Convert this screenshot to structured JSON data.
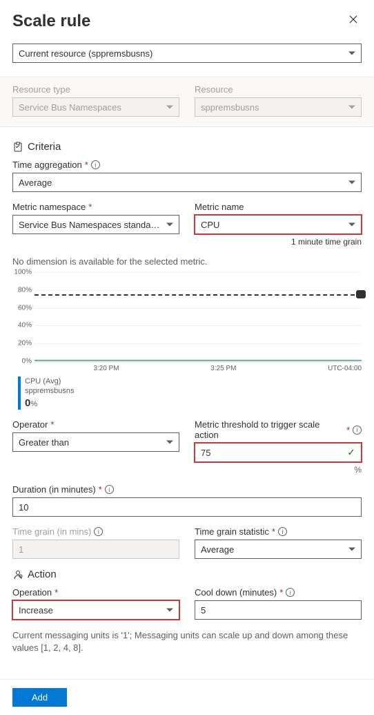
{
  "header": {
    "title": "Scale rule"
  },
  "scope_select": {
    "value": "Current resource (sppremsbusns)"
  },
  "resource_type": {
    "label": "Resource type",
    "value": "Service Bus Namespaces"
  },
  "resource": {
    "label": "Resource",
    "value": "sppremsbusns"
  },
  "criteria": {
    "title": "Criteria"
  },
  "time_agg": {
    "label": "Time aggregation",
    "value": "Average"
  },
  "metric_ns": {
    "label": "Metric namespace",
    "value": "Service Bus Namespaces standard me..."
  },
  "metric_name": {
    "label": "Metric name",
    "value": "CPU"
  },
  "time_grain_note": "1 minute time grain",
  "no_dim_msg": "No dimension is available for the selected metric.",
  "chart_data": {
    "type": "line",
    "yticks": [
      "100%",
      "80%",
      "60%",
      "40%",
      "20%",
      "0%"
    ],
    "xticks": [
      "3:20 PM",
      "3:25 PM",
      "UTC-04:00"
    ],
    "threshold": 75,
    "series": [
      {
        "name": "CPU (Avg)",
        "resource": "sppremsbusns",
        "value_display": "0",
        "unit": "%"
      }
    ],
    "ylim": [
      0,
      100
    ]
  },
  "operator": {
    "label": "Operator",
    "value": "Greater than"
  },
  "threshold": {
    "label": "Metric threshold to trigger scale action",
    "value": "75",
    "unit": "%"
  },
  "duration": {
    "label": "Duration (in minutes)",
    "value": "10"
  },
  "time_grain": {
    "label": "Time grain (in mins)",
    "value": "1"
  },
  "time_grain_stat": {
    "label": "Time grain statistic",
    "value": "Average"
  },
  "action": {
    "title": "Action"
  },
  "operation": {
    "label": "Operation",
    "value": "Increase"
  },
  "cooldown": {
    "label": "Cool down (minutes)",
    "value": "5"
  },
  "units_hint": "Current messaging units is '1'; Messaging units can scale up and down among these values [1, 2, 4, 8].",
  "add_button": "Add"
}
